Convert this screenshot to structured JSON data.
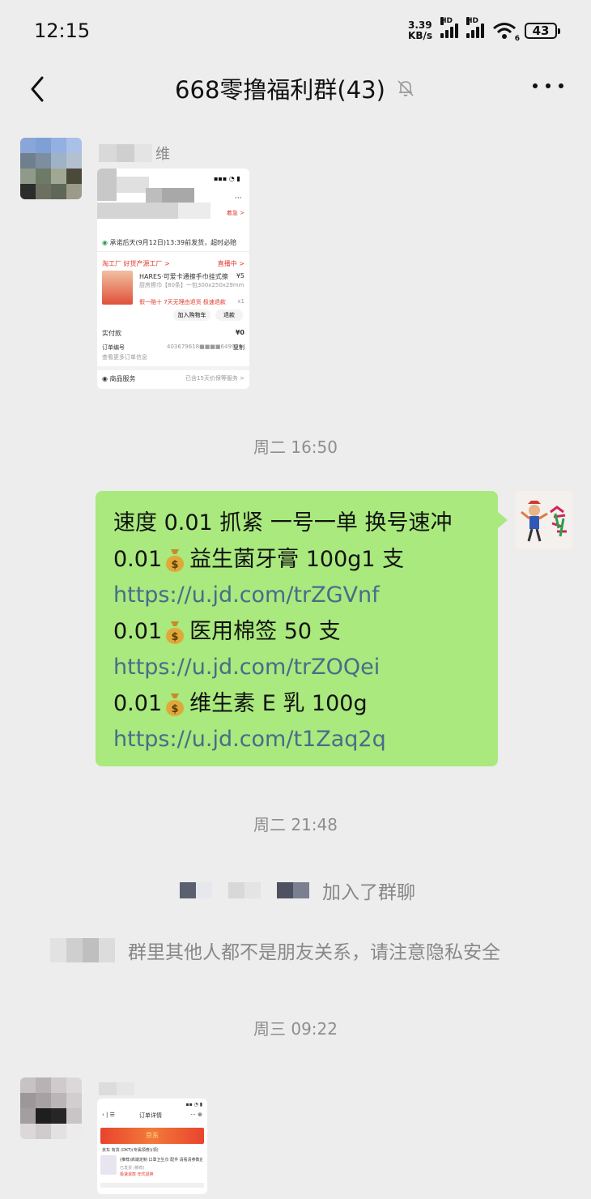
{
  "status_bar": {
    "time": "12:15",
    "speed_value": "3.39",
    "speed_unit": "KB/s",
    "hd1": "HD",
    "hd2": "HD",
    "wifi_badge": "6",
    "battery": "43"
  },
  "header": {
    "title": "668零撸福利群(43)",
    "muted_icon": "bell-off-icon",
    "more_icon": "more-icon",
    "back_icon": "chevron-left-icon"
  },
  "messages": {
    "msg1": {
      "sender_name_visible": "维",
      "screenshot": {
        "top_link": "着急 >",
        "delivery": "承诺后天(9月12日)13:39前发货，超时必赔",
        "store": "淘工厂 好货产源工厂 >",
        "live_badge": "直播中 >",
        "product_title": "HARES·可爱卡通擦手巾挂式擦",
        "product_spec": "厨房擦巾【80条】一包300x250x29mm",
        "product_price": "¥5",
        "promo": "假一赔十  7天无理由退货  极速退款",
        "qty": "x1",
        "btn_cart": "加入购物车",
        "btn_refund": "退款",
        "paid_label": "实付款",
        "paid_value": "¥0",
        "order_label": "订单编号",
        "order_value": "403679618■■■■649929",
        "copy": "复制",
        "more_info": "查看更多订单信息",
        "service_label": "商品服务",
        "service_value": "已含15天价保等服务 >"
      }
    },
    "time1": "周二 16:50",
    "msg2": {
      "lines": [
        {
          "text": "速度 0.01 抓紧  一号一单  换号速冲",
          "money": false,
          "link": false
        },
        {
          "price": "0.01",
          "text": "益生菌牙膏 100g1 支",
          "money": true,
          "link": false
        },
        {
          "text": "https://u.jd.com/trZGVnf",
          "money": false,
          "link": true
        },
        {
          "price": "0.01",
          "text": "医用棉签 50 支",
          "money": true,
          "link": false
        },
        {
          "text": "https://u.jd.com/trZOQei",
          "money": false,
          "link": true
        },
        {
          "price": "0.01",
          "text": "维生素 E 乳 100g",
          "money": true,
          "link": false
        },
        {
          "text": "https://u.jd.com/t1Zaq2q",
          "money": false,
          "link": true
        }
      ],
      "money_icon": "money-bag-icon"
    },
    "time2": "周二 21:48",
    "join_notice": "加入了群聊",
    "privacy_notice": "群里其他人都不是朋友关系，请注意隐私安全",
    "time3": "周三 09:22",
    "msg3": {
      "screenshot": {
        "header_title": "订单详情",
        "banner": "京东",
        "row1": "京东 有货  (DKT)(专属领券)(领)",
        "row2": "(推荐)高端定制  口罩卫生巾  配件  请看清参数后下单购买",
        "row3": "已发货  (推荐)",
        "row4": "极速退款  无忧退换"
      }
    }
  }
}
